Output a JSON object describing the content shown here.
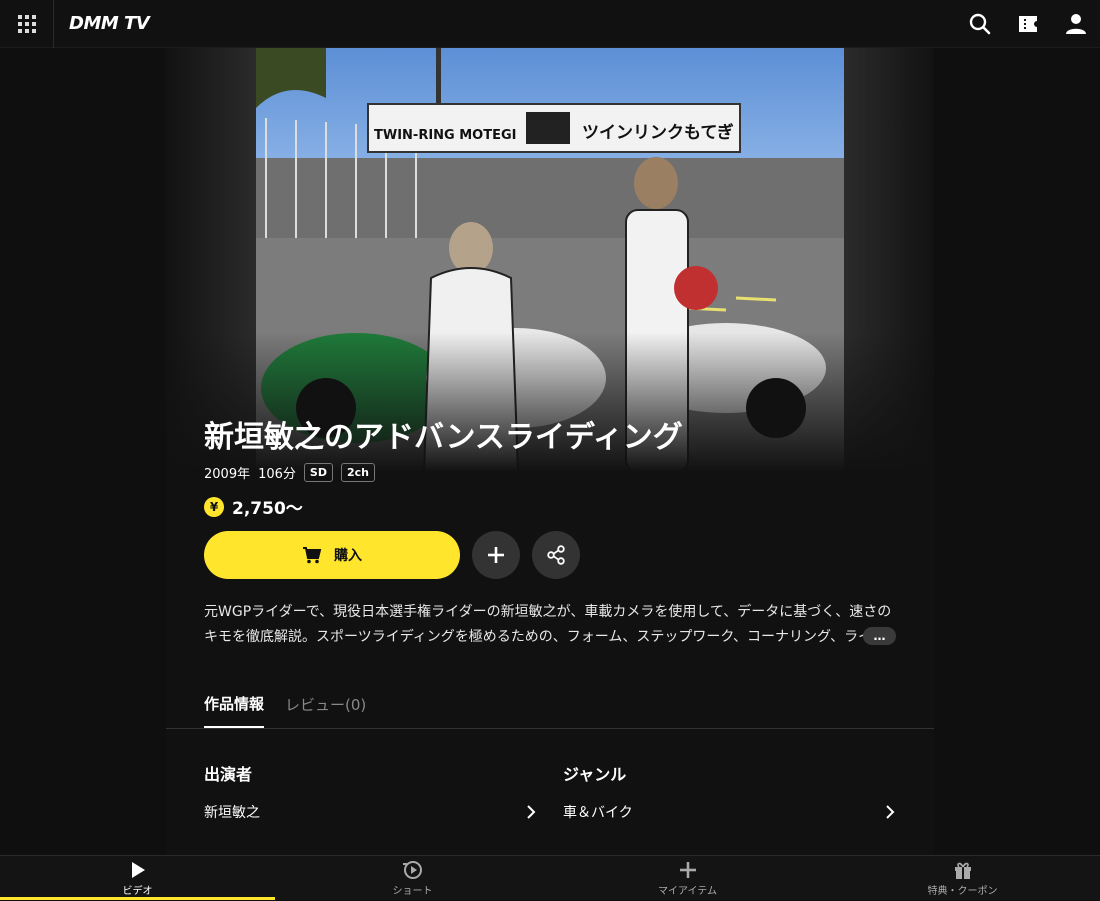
{
  "header": {
    "logo": "DMM TV"
  },
  "content": {
    "title": "新垣敏之のアドバンスライディング",
    "year": "2009年",
    "duration": "106分",
    "badges": [
      "SD",
      "2ch"
    ],
    "price_symbol": "¥",
    "price": "2,750〜",
    "buy_label": "購入",
    "description": "元WGPライダーで、現役日本選手権ライダーの新垣敏之が、車載カメラを使用して、データに基づく、速さのキモを徹底解説。スポーツライディングを極めるための、フォーム、ステップワーク、コーナリング、ライン取りまで",
    "more_label": "…",
    "hero_sign_en": "TWIN-RING MOTEGI",
    "hero_sign_jp": "ツインリンクもてぎ"
  },
  "tabs": [
    {
      "label": "作品情報",
      "active": true
    },
    {
      "label": "レビュー(0)",
      "active": false
    }
  ],
  "info": {
    "cast_heading": "出演者",
    "cast_value": "新垣敏之",
    "genre_heading": "ジャンル",
    "genre_value": "車＆バイク"
  },
  "bottom_nav": [
    {
      "label": "ビデオ",
      "icon": "play-icon",
      "active": true
    },
    {
      "label": "ショート",
      "icon": "short-icon",
      "active": false
    },
    {
      "label": "マイアイテム",
      "icon": "plus-icon",
      "active": false
    },
    {
      "label": "特典・クーポン",
      "icon": "gift-icon",
      "active": false
    }
  ],
  "colors": {
    "accent": "#ffe62c",
    "background": "#0f0f0f"
  }
}
